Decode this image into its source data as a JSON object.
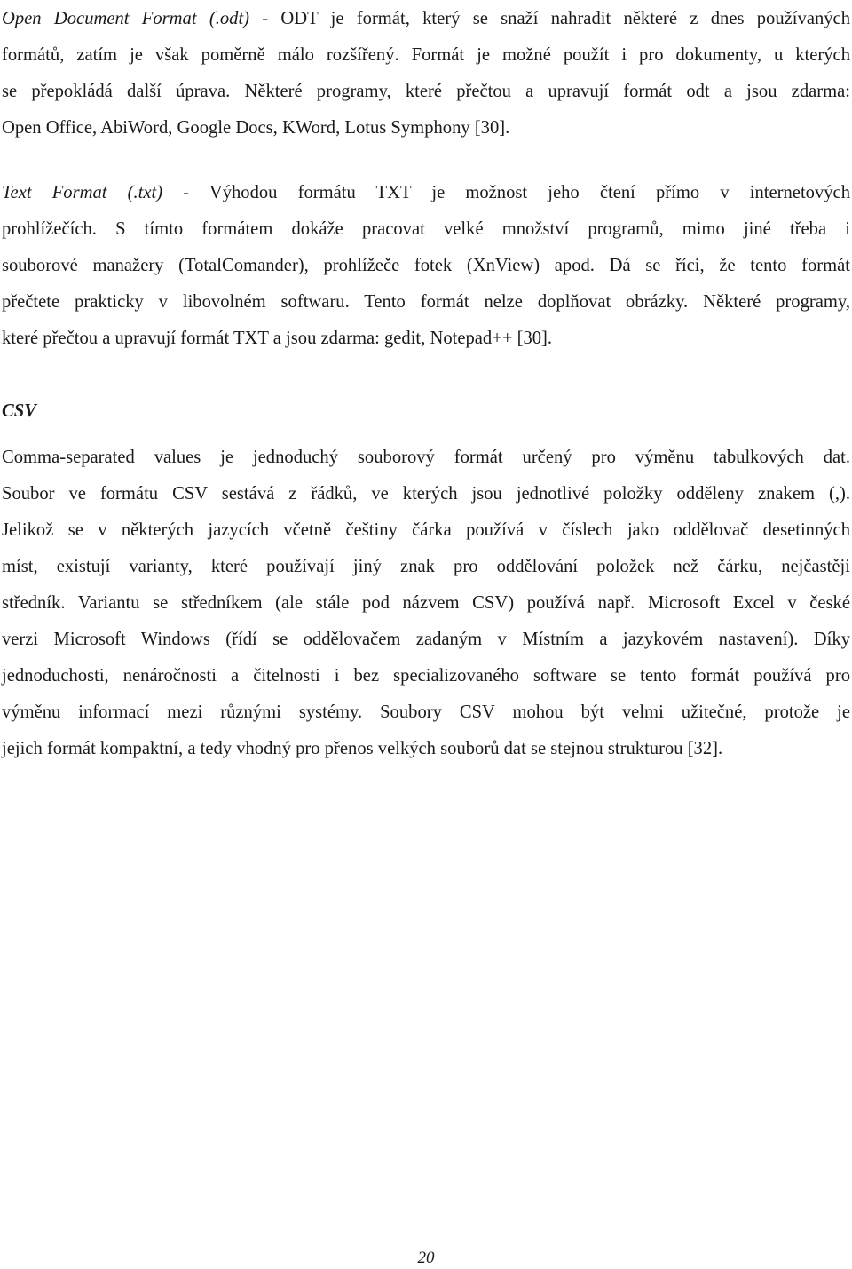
{
  "document": {
    "paragraph_odt": {
      "term": "Open Document Format (.odt)",
      "lines": [
        " - ODT je formát, který se snaží nahradit některé z dnes používaných",
        "formátů, zatím je však poměrně málo rozšířený. Formát je možné použít i pro dokumenty, u kterých",
        "se přepokládá další úprava. Některé programy, které přečtou a upravují formát odt a jsou zdarma:",
        "Open Office, AbiWord, Google Docs, KWord, Lotus Symphony [30]."
      ]
    },
    "paragraph_txt": {
      "term": "Text Format (.txt)",
      "lines": [
        " - Výhodou formátu TXT je možnost jeho čtení přímo v internetových",
        "prohlížečích. S tímto formátem dokáže pracovat velké množství programů, mimo jiné třeba i",
        "souborové manažery (TotalComander), prohlížeče fotek (XnView) apod. Dá se říci, že tento formát",
        "přečtete prakticky v libovolném softwaru. Tento formát nelze doplňovat obrázky. Některé programy,",
        "které přečtou a upravují formát TXT a jsou zdarma: gedit, Notepad++ [30]."
      ]
    },
    "csv_heading": "CSV",
    "paragraph_csv": {
      "lines": [
        "Comma-separated values je jednoduchý souborový formát určený pro výměnu tabulkových dat.",
        "Soubor ve formátu CSV sestává z řádků, ve kterých jsou jednotlivé položky odděleny znakem (,).",
        "Jelikož se v některých jazycích včetně češtiny čárka používá v číslech jako oddělovač desetinných",
        "míst, existují varianty, které používají jiný znak pro oddělování položek než čárku, nejčastěji",
        "středník. Variantu se středníkem (ale stále pod názvem CSV) používá např. Microsoft Excel v české",
        "verzi Microsoft Windows (řídí se oddělovačem zadaným v Místním a jazykovém nastavení). Díky",
        "jednoduchosti, nenáročnosti a čitelnosti i bez specializovaného software se tento formát používá pro",
        "výměnu informací mezi různými systémy. Soubory CSV mohou být velmi užitečné, protože je",
        "jejich formát kompaktní, a tedy vhodný pro přenos velkých souborů dat se stejnou strukturou [32]."
      ]
    },
    "page_number": "20"
  }
}
